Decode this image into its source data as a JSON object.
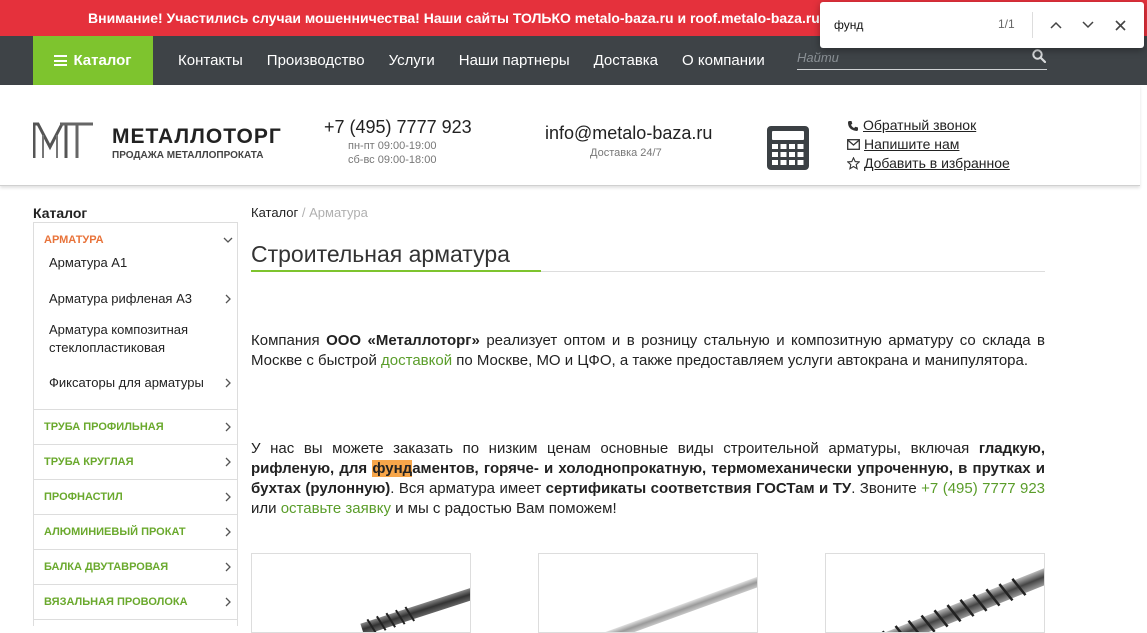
{
  "alert": {
    "text": "Внимание! Участились случаи мошенничества! Наши сайты ТОЛЬКО metalo-baza.ru и roof.metalo-baza.ru! К другим сайтам"
  },
  "nav": {
    "catalog_label": "Каталог",
    "links": [
      "Контакты",
      "Производство",
      "Услуги",
      "Наши партнеры",
      "Доставка",
      "О компании"
    ],
    "search_placeholder": "Найти"
  },
  "find": {
    "query": "фунд",
    "count": "1/1"
  },
  "header": {
    "logo_name": "МЕТАЛЛОТОРГ",
    "logo_sub": "ПРОДАЖА МЕТАЛЛОПРОКАТА",
    "phone": "+7 (495) 7777 923",
    "hours_weekday": "пн-пт 09:00-19:00",
    "hours_weekend": "сб-вс 09:00-18:00",
    "email": "info@metalo-baza.ru",
    "delivery": "Доставка 24/7",
    "links": {
      "callback": "Обратный звонок",
      "write": "Напишите нам",
      "favorite": "Добавить в избранное"
    }
  },
  "sidebar": {
    "title": "Каталог",
    "active": {
      "label": "Арматура",
      "items": [
        "Арматура А1",
        "Арматура рифленая А3",
        "Арматура композитная стеклопластиковая",
        "Фиксаторы для арматуры"
      ]
    },
    "categories": [
      "Труба профильная",
      "Труба круглая",
      "Профнастил",
      "Алюминиевый прокат",
      "Балка двутавровая",
      "Вязальная проволока"
    ]
  },
  "main": {
    "breadcrumb_root": "Каталог",
    "breadcrumb_sep": " / ",
    "breadcrumb_current": "Арматура",
    "title": "Строительная арматура",
    "p1": {
      "t1": "Компания ",
      "b1": "ООО «Металлоторг»",
      "t2": " реализует оптом и в розницу стальную и композитную арматуру со склада в Москве с быстрой ",
      "link": "доставкой",
      "t3": " по Москве, МО и ЦФО, а также предоставляем услуги автокрана и манипулятора."
    },
    "p2": {
      "t1": "У нас вы можете заказать по низким ценам основные виды строительной арматуры, включая ",
      "b1": "гладкую, рифленую, для ",
      "hl": "фунд",
      "b2": "аментов, горяче- и холоднопрокатную, термомеханически упроченную, в прутках и бухтах (рулонную)",
      "t2": ". Вся арматура имеет ",
      "b3": "сертификаты соответствия ГОСТам и ТУ",
      "t3": ". Звоните ",
      "phone": "+7 (495) 7777 923",
      "t4": " или ",
      "link": "оставьте заявку",
      "t5": " и мы с радостью Вам поможем!"
    }
  },
  "colors": {
    "alert": "#e5313c",
    "nav": "#3e4347",
    "accent": "#7ec42e",
    "active_cat": "#e8733a",
    "link_green": "#5a9d2a"
  }
}
